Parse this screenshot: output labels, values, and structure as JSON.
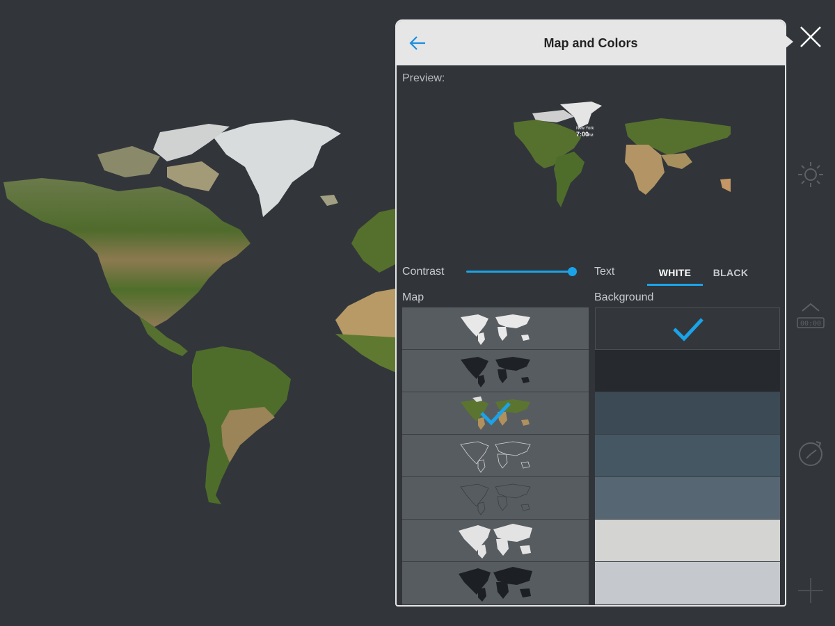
{
  "panel": {
    "title": "Map and Colors",
    "preview_label": "Preview:",
    "preview_clock": {
      "city": "New York",
      "time": "7:00",
      "ampm": "PM"
    }
  },
  "contrast": {
    "label": "Contrast",
    "value": 1.0
  },
  "text_color": {
    "label": "Text",
    "options": [
      "WHITE",
      "BLACK"
    ],
    "selected": "WHITE"
  },
  "map_section": {
    "label": "Map",
    "options": [
      {
        "style": "white-silhouette"
      },
      {
        "style": "black-silhouette"
      },
      {
        "style": "satellite",
        "selected": true
      },
      {
        "style": "white-outline"
      },
      {
        "style": "dark-outline"
      },
      {
        "style": "white-large-silhouette"
      },
      {
        "style": "black-large-silhouette"
      }
    ]
  },
  "background_section": {
    "label": "Background",
    "swatches": [
      {
        "color": "#33373c",
        "selected": true
      },
      {
        "color": "#262a2f"
      },
      {
        "color": "#3c4a55"
      },
      {
        "color": "#465764"
      },
      {
        "color": "#566773"
      },
      {
        "color": "#d4d5d2"
      },
      {
        "color": "#c5c8cd"
      }
    ]
  },
  "colors": {
    "accent": "#1aa3e8",
    "panel_bg": "#31353a",
    "header_bg": "#e6e6e6",
    "page_bg": "#32363b"
  },
  "rail_icons": [
    "close-icon",
    "brightness-icon",
    "alarm-clock-icon",
    "timer-icon",
    "add-icon"
  ]
}
